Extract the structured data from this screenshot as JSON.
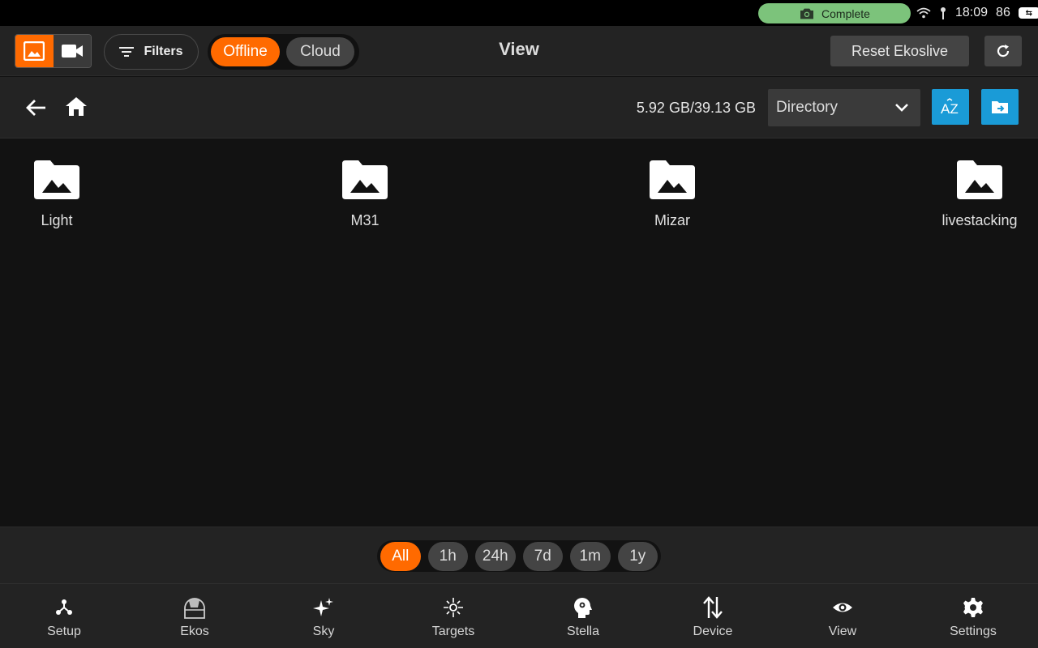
{
  "status_bar": {
    "status_pill_text": "Complete",
    "status_pill_color": "#7cc37b",
    "time": "18:09",
    "battery_level": "86"
  },
  "toolbar": {
    "modes": [
      {
        "icon": "image-icon",
        "active": true
      },
      {
        "icon": "video-camera-icon",
        "active": false
      }
    ],
    "filters_label": "Filters",
    "source_options": [
      "Offline",
      "Cloud"
    ],
    "source_selected": "Offline",
    "title": "View",
    "reset_label": "Reset Ekoslive",
    "accent_color": "#ff6a00"
  },
  "nav": {
    "storage": "5.92 GB/39.13 GB",
    "sort_selected": "Directory",
    "sort_button_icon": "sort-az-icon",
    "folder_button_icon": "folder-export-icon",
    "button_color": "#1a9bd7"
  },
  "folders": [
    {
      "name": "Light"
    },
    {
      "name": "M31"
    },
    {
      "name": "Mizar"
    },
    {
      "name": "livestacking"
    }
  ],
  "time_filters": {
    "options": [
      "All",
      "1h",
      "24h",
      "7d",
      "1m",
      "1y"
    ],
    "selected": "All"
  },
  "tabs": [
    {
      "label": "Setup",
      "icon": "setup-icon"
    },
    {
      "label": "Ekos",
      "icon": "observatory-dome-icon"
    },
    {
      "label": "Sky",
      "icon": "sparkles-icon"
    },
    {
      "label": "Targets",
      "icon": "target-star-icon"
    },
    {
      "label": "Stella",
      "icon": "head-gear-icon"
    },
    {
      "label": "Device",
      "icon": "transfer-arrows-icon"
    },
    {
      "label": "View",
      "icon": "eye-icon"
    },
    {
      "label": "Settings",
      "icon": "gear-icon"
    }
  ]
}
